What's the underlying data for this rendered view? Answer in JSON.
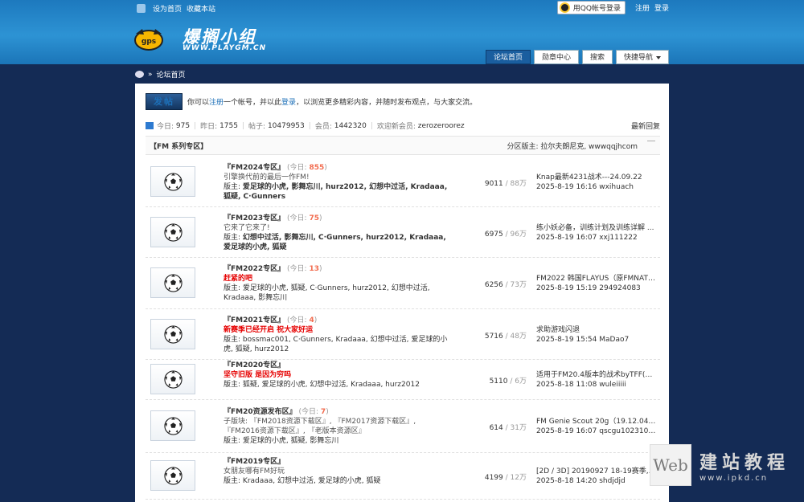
{
  "topbar": {
    "set_home": "设为首页",
    "bookmark": "收藏本站",
    "qq_login": "用QQ帐号登录",
    "register": "注册",
    "login": "登录"
  },
  "logo": {
    "title": "爆搁小组",
    "url": "WWW.PLAYGM.CN",
    "ball_text": "gps"
  },
  "nav": {
    "items": [
      "论坛首页",
      "勋章中心",
      "搜索",
      "快捷导航"
    ]
  },
  "breadcrumb": {
    "sep": "»",
    "current": "论坛首页"
  },
  "notice": {
    "post_button": "发帖",
    "t1": "你可以",
    "register": "注册",
    "t2": "一个帐号，并以此",
    "login": "登录",
    "t3": "，以浏览更多精彩内容，并随时发布观点，与大家交流。"
  },
  "stats": {
    "today_label": "今日:",
    "today": "975",
    "yesterday_label": "昨日:",
    "yesterday": "1755",
    "posts_label": "帖子:",
    "posts": "10479953",
    "members_label": "会员:",
    "members": "1442320",
    "newest_label": "欢迎新会员:",
    "newest": "zerozeroorez",
    "recent_reply": "最新回复"
  },
  "category": {
    "title": "【FM 系列专区】",
    "mods": "分区版主: 拉尔夫朗尼克, wwwqqjhcom"
  },
  "forums": [
    {
      "name": "『FM2024专区』",
      "today_pre": "(今日: ",
      "today": "855",
      "today_post": ")",
      "desc": "引擎换代前的最后一作FM!",
      "desc_red": false,
      "mods_label": "版主:",
      "mods": "爱足球的小虎, 影舞忘川, hurz2012, 幻想中过活, Kradaaa, 狐疑, C·Gunners",
      "mods_bold": true,
      "threads": "9011",
      "posts": "88万",
      "last_title": "Knap最新4231战术---24.09.22",
      "last_meta": "2025-8-19 16:16 wxihuach"
    },
    {
      "name": "『FM2023专区』",
      "today_pre": "(今日: ",
      "today": "75",
      "today_post": ")",
      "desc": "它来了它来了!",
      "desc_red": false,
      "mods_label": "版主:",
      "mods": "幻想中过活, 影舞忘川, C·Gunners, hurz2012, Kradaaa, 爱足球的小虎, 狐疑",
      "mods_bold": true,
      "threads": "6975",
      "posts": "96万",
      "last_title": "练小妖必备，训练计划及训练详解 ...",
      "last_meta": "2025-8-19 16:07 xxj111222"
    },
    {
      "name": "『FM2022专区』",
      "today_pre": "(今日: ",
      "today": "13",
      "today_post": ")",
      "desc": "赶紧的吧",
      "desc_red": true,
      "mods_label": "版主:",
      "mods": "爱足球的小虎, 狐疑, C·Gunners, hurz2012, 幻想中过活, Kradaaa, 影舞忘川",
      "mods_bold": false,
      "threads": "6256",
      "posts": "73万",
      "last_title": "FM2022 韩国FLAYUS（原FMNATION ...",
      "last_meta": "2025-8-19 15:19 294924083"
    },
    {
      "name": "『FM2021专区』",
      "today_pre": "(今日: ",
      "today": "4",
      "today_post": ")",
      "desc": "新赛季已经开启 祝大家好运",
      "desc_red": true,
      "mods_label": "版主:",
      "mods": "bossmac001, C·Gunners, Kradaaa, 幻想中过活, 爱足球的小虎, 狐疑, hurz2012",
      "mods_bold": false,
      "threads": "5716",
      "posts": "48万",
      "last_title": "求助游戏闪退",
      "last_meta": "2025-8-19 15:54 MaDao7"
    },
    {
      "name": "『FM2020专区』",
      "today_pre": "",
      "today": "",
      "today_post": "",
      "desc": "坚守旧版 是因为穷吗",
      "desc_red": true,
      "mods_label": "版主:",
      "mods": "狐疑, 爱足球的小虎, 幻想中过活, Kradaaa, hurz2012",
      "mods_bold": false,
      "threads": "5110",
      "posts": "6万",
      "last_title": "适用于FM20.4版本的战术byTFF(20 ...",
      "last_meta": "2025-8-18 11:08 wuleiiiii"
    },
    {
      "name": "『FM20资源发布区』",
      "today_pre": "(今日: ",
      "today": "7",
      "today_post": ")",
      "desc": "子版块: 『FM2018资源下载区』, 『FM2017资源下载区』, 『FM2016资源下载区』, 『老版本资源区』",
      "desc_red": false,
      "mods_label": "版主:",
      "mods": "爱足球的小虎, 狐疑, 影舞忘川",
      "mods_bold": false,
      "threads": "614",
      "posts": "31万",
      "last_title": "FM Genie Scout 20g（19.12.04更 ...",
      "last_meta": "2025-8-19 16:07 qscgu10231023"
    },
    {
      "name": "『FM2019专区』",
      "today_pre": "",
      "today": "",
      "today_post": "",
      "desc": "女朋友哪有FM好玩",
      "desc_red": false,
      "mods_label": "版主:",
      "mods": "Kradaaa, 幻想中过活, 爱足球的小虎, 狐疑",
      "mods_bold": false,
      "threads": "4199",
      "posts": "12万",
      "last_title": "[2D / 3D] 20190927 18-19赛季, ...",
      "last_meta": "2025-8-18 14:20 shdjdjd"
    }
  ],
  "watermark": {
    "box": "Web",
    "cn": "建站教程",
    "url": "www.ipkd.cn"
  }
}
